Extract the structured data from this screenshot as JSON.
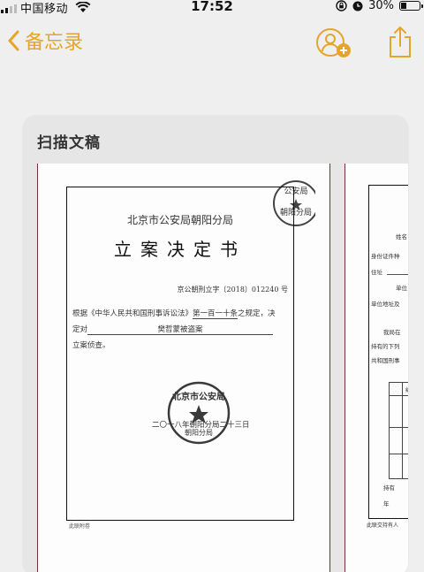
{
  "status_bar": {
    "carrier": "中国移动",
    "time": "17:52",
    "battery": "30%",
    "battery_level": 0.3
  },
  "nav": {
    "back_label": "备忘录"
  },
  "scan": {
    "title": "扫描文稿",
    "page1": {
      "agency": "北京市公安局朝阳分局",
      "doc_title": "立案决定书",
      "doc_number": "京公朝刑立字〔2018〕012240 号",
      "body_line1_prefix": "根据《中华人民共和国刑事诉讼法》",
      "body_line1_article": "第一百一十条",
      "body_line1_suffix": "之规定，决",
      "body_line2_prefix": "定对",
      "body_line2_case": "樊哲蒙被盗案",
      "body_line3": "立案侦查。",
      "date": "二〇一八年朝阳分局二十三日",
      "footer": "此联附卷",
      "stamp_text": "北京市公安局",
      "stamp_sub": "朝阳分局",
      "top_stamp_text": "公安局",
      "top_stamp_sub": "朝阳分局"
    },
    "page2": {
      "labels": [
        "姓名",
        "身份证件种",
        "住址",
        "单位",
        "单位地址及"
      ],
      "text_lines": [
        "我局在",
        "持有的下列",
        "共和国刑事"
      ],
      "table_head": "编号",
      "table_cell": "1",
      "bottom_lines": [
        "持有",
        "年"
      ],
      "footer": "此联交持有人"
    }
  }
}
